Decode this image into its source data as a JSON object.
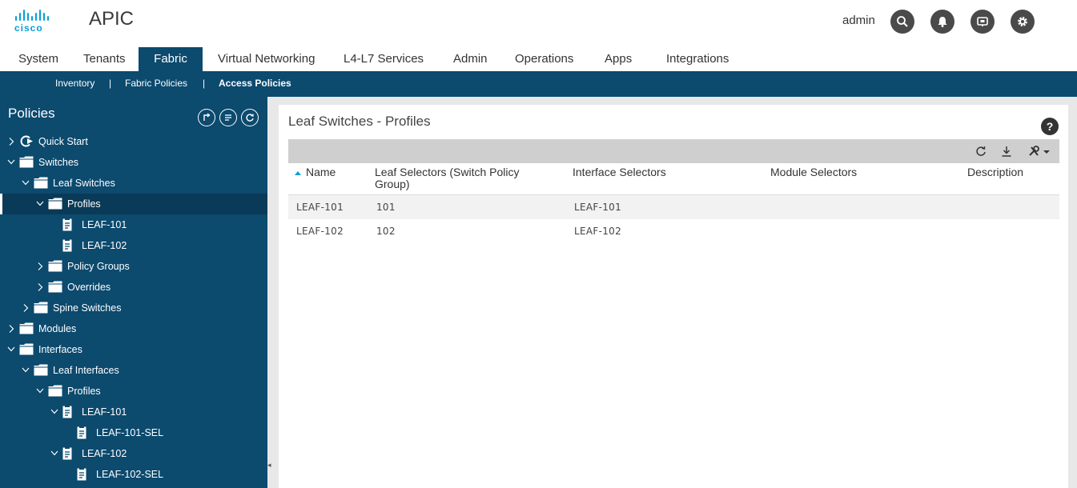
{
  "header": {
    "logo_text": "cisco",
    "app_title": "APIC",
    "username": "admin",
    "icons": [
      "search-icon",
      "bell-icon",
      "feedback-icon",
      "gear-icon"
    ]
  },
  "tabs": [
    {
      "label": "System",
      "active": false
    },
    {
      "label": "Tenants",
      "active": false
    },
    {
      "label": "Fabric",
      "active": true
    },
    {
      "label": "Virtual Networking",
      "active": false
    },
    {
      "label": "L4-L7 Services",
      "active": false
    },
    {
      "label": "Admin",
      "active": false
    },
    {
      "label": "Operations",
      "active": false
    },
    {
      "label": "Apps",
      "active": false
    },
    {
      "label": "Integrations",
      "active": false
    }
  ],
  "subnav": {
    "items": [
      {
        "label": "Inventory",
        "active": false
      },
      {
        "label": "Fabric Policies",
        "active": false
      },
      {
        "label": "Access Policies",
        "active": true
      }
    ],
    "separator": "|"
  },
  "sidebar": {
    "title": "Policies",
    "tree": [
      {
        "label": "Quick Start",
        "level": 0,
        "expand": "collapsed",
        "icon": "quickstart"
      },
      {
        "label": "Switches",
        "level": 0,
        "expand": "expanded",
        "icon": "folder"
      },
      {
        "label": "Leaf Switches",
        "level": 1,
        "expand": "expanded",
        "icon": "folder"
      },
      {
        "label": "Profiles",
        "level": 2,
        "expand": "expanded",
        "icon": "folder",
        "selected": true
      },
      {
        "label": "LEAF-101",
        "level": 3,
        "expand": "none",
        "icon": "doc"
      },
      {
        "label": "LEAF-102",
        "level": 3,
        "expand": "none",
        "icon": "doc"
      },
      {
        "label": "Policy Groups",
        "level": 2,
        "expand": "collapsed",
        "icon": "folder"
      },
      {
        "label": "Overrides",
        "level": 2,
        "expand": "collapsed",
        "icon": "folder"
      },
      {
        "label": "Spine Switches",
        "level": 1,
        "expand": "collapsed",
        "icon": "folder"
      },
      {
        "label": "Modules",
        "level": 0,
        "expand": "collapsed",
        "icon": "folder"
      },
      {
        "label": "Interfaces",
        "level": 0,
        "expand": "expanded",
        "icon": "folder"
      },
      {
        "label": "Leaf Interfaces",
        "level": 1,
        "expand": "expanded",
        "icon": "folder"
      },
      {
        "label": "Profiles",
        "level": 2,
        "expand": "expanded",
        "icon": "folder"
      },
      {
        "label": "LEAF-101",
        "level": 3,
        "expand": "expanded",
        "icon": "doc"
      },
      {
        "label": "LEAF-101-SEL",
        "level": 4,
        "expand": "none",
        "icon": "doc"
      },
      {
        "label": "LEAF-102",
        "level": 3,
        "expand": "expanded",
        "icon": "doc"
      },
      {
        "label": "LEAF-102-SEL",
        "level": 4,
        "expand": "none",
        "icon": "doc"
      }
    ]
  },
  "content": {
    "title": "Leaf Switches - Profiles",
    "help": "?",
    "columns": [
      {
        "label": "Name",
        "sorted": "asc"
      },
      {
        "label": "Leaf Selectors (Switch Policy Group)"
      },
      {
        "label": "Interface Selectors"
      },
      {
        "label": "Module Selectors"
      },
      {
        "label": "Description"
      }
    ],
    "rows": [
      {
        "name": "LEAF-101",
        "leaf_selectors": "101",
        "interface_selectors": "LEAF-101",
        "module_selectors": "",
        "description": ""
      },
      {
        "name": "LEAF-102",
        "leaf_selectors": "102",
        "interface_selectors": "LEAF-102",
        "module_selectors": "",
        "description": ""
      }
    ]
  }
}
